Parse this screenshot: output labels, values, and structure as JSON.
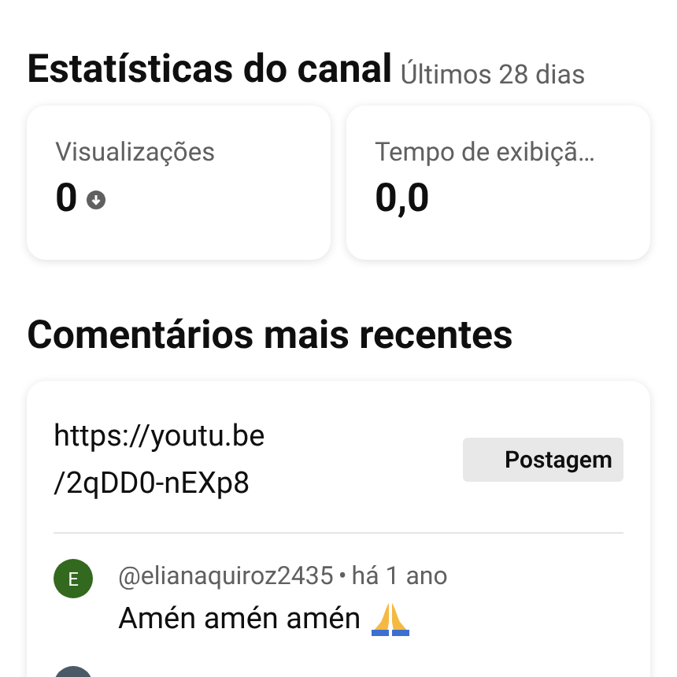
{
  "stats": {
    "title": "Estatísticas do canal",
    "period": "Últimos 28 dias",
    "cards": [
      {
        "label": "Visualizações",
        "value": "0",
        "falling": true
      },
      {
        "label": "Tempo de exibiçã…",
        "value": "0,0",
        "falling": false
      }
    ]
  },
  "comments": {
    "title": "Comentários mais recentes",
    "link": "https://youtu.be\n/2qDD0-nEXp8",
    "badge": "Postagem",
    "items": [
      {
        "initial": "E",
        "color": "#33691e",
        "author": "@elianaquiroz2435",
        "separator": "•",
        "time": "há 1 ano",
        "text": "Amén amén amén"
      }
    ]
  }
}
